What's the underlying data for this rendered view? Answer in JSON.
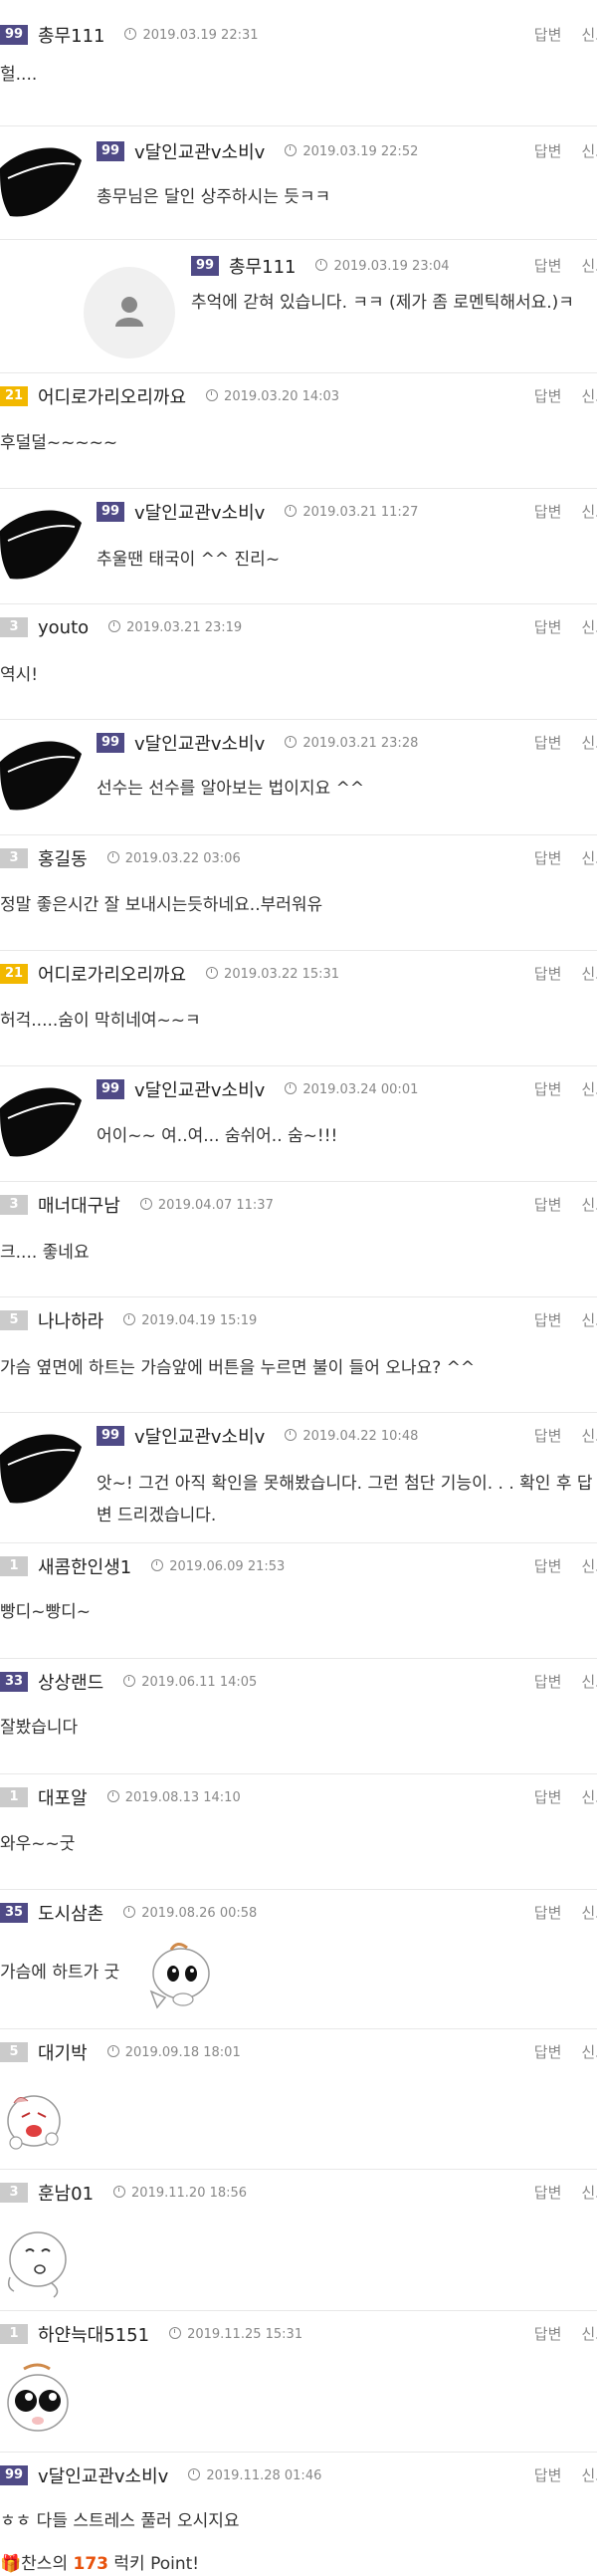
{
  "actions": {
    "reply": "답변",
    "report": "신고"
  },
  "comments": [
    {
      "level": "99",
      "user": "총무111",
      "date": "2019.03.19 22:31",
      "text": "헐...."
    },
    {
      "level": "99",
      "user": "v달인교관v소비v",
      "date": "2019.03.19 22:52",
      "text": "총무님은 달인 상주하시는 듯ㅋㅋ"
    },
    {
      "level": "99",
      "user": "총무111",
      "date": "2019.03.19 23:04",
      "text": "추억에 갇혀 있습니다. ㅋㅋ (제가 좀 로멘틱해서요.)ㅋ"
    },
    {
      "level": "21",
      "user": "어디로가리오리까요",
      "date": "2019.03.20 14:03",
      "text": "후덜덜~~~~~"
    },
    {
      "level": "99",
      "user": "v달인교관v소비v",
      "date": "2019.03.21 11:27",
      "text": "추울땐 태국이 ^^ 진리~"
    },
    {
      "level": "3",
      "user": "youto",
      "date": "2019.03.21 23:19",
      "text": "역시!"
    },
    {
      "level": "99",
      "user": "v달인교관v소비v",
      "date": "2019.03.21 23:28",
      "text": "선수는 선수를 알아보는 법이지요 ^^"
    },
    {
      "level": "3",
      "user": "홍길동",
      "date": "2019.03.22 03:06",
      "text": "정말 좋은시간 잘 보내시는듯하네요..부러워유"
    },
    {
      "level": "21",
      "user": "어디로가리오리까요",
      "date": "2019.03.22 15:31",
      "text": "허걱.....숨이 막히네여~~ㅋ"
    },
    {
      "level": "99",
      "user": "v달인교관v소비v",
      "date": "2019.03.24 00:01",
      "text": "어이~~ 여..여... 숨쉬어.. 숨~!!!"
    },
    {
      "level": "3",
      "user": "매너대구남",
      "date": "2019.04.07 11:37",
      "text": "크.... 좋네요"
    },
    {
      "level": "5",
      "user": "나나하라",
      "date": "2019.04.19 15:19",
      "text": "가슴 옆면에 하트는 가슴앞에 버튼을 누르면 불이 들어 오나요? ^^"
    },
    {
      "level": "99",
      "user": "v달인교관v소비v",
      "date": "2019.04.22 10:48",
      "text": "앗~! 그건 아직 확인을 못해봤습니다. 그런 첨단 기능이. . . 확인 후 답변 드리겠습니다."
    },
    {
      "level": "1",
      "user": "새콤한인생1",
      "date": "2019.06.09 21:53",
      "text": "빵디~빵디~"
    },
    {
      "level": "33",
      "user": "상상랜드",
      "date": "2019.06.11 14:05",
      "text": "잘봤습니다"
    },
    {
      "level": "1",
      "user": "대포알",
      "date": "2019.08.13 14:10",
      "text": "와우~~굿"
    },
    {
      "level": "35",
      "user": "도시삼촌",
      "date": "2019.08.26 00:58",
      "text": "가슴에 하트가 굿"
    },
    {
      "level": "5",
      "user": "대기박",
      "date": "2019.09.18 18:01",
      "text": ""
    },
    {
      "level": "3",
      "user": "훈남01",
      "date": "2019.11.20 18:56",
      "text": ""
    },
    {
      "level": "1",
      "user": "하얀늑대5151",
      "date": "2019.11.25 15:31",
      "text": ""
    },
    {
      "level": "99",
      "user": "v달인교관v소비v",
      "date": "2019.11.28 01:46",
      "text": "ㅎㅎ 다들 스트레스 풀러 오시지요"
    }
  ],
  "footer": {
    "prefix": "찬스의 ",
    "points": "173",
    "suffix": " 럭키 Point!"
  }
}
